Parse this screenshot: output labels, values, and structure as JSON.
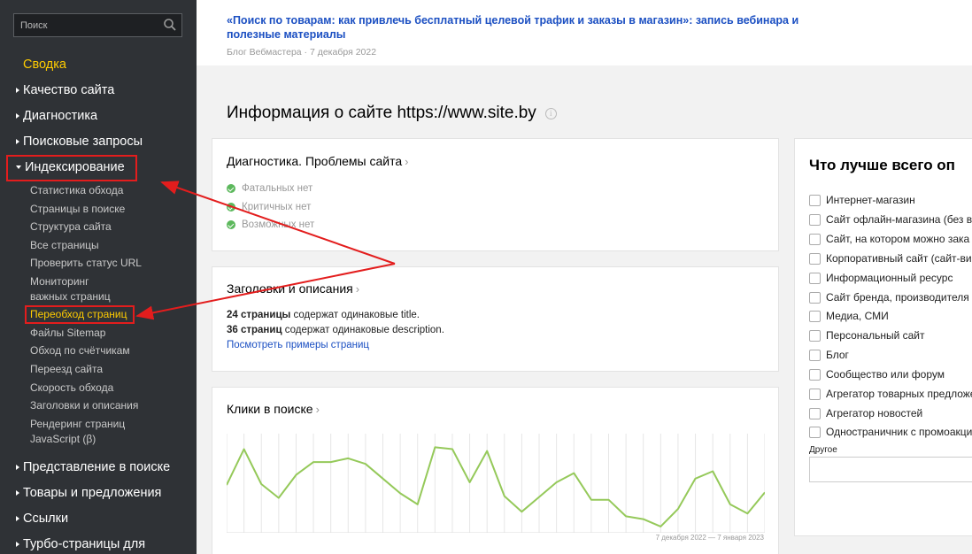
{
  "search": {
    "placeholder": "Поиск",
    "icon": "search-icon"
  },
  "sidebar": {
    "summary": "Сводка",
    "sections": [
      "Качество сайта",
      "Диагностика",
      "Поисковые запросы",
      "Индексирование",
      "Представление в поиске",
      "Товары и предложения",
      "Ссылки",
      "Турбо-страницы для"
    ],
    "indexing_items": [
      "Статистика обхода",
      "Страницы в поиске",
      "Структура сайта",
      "Все страницы",
      "Проверить статус URL",
      "Мониторинг",
      "важных страниц",
      "Переобход страниц",
      "Файлы Sitemap",
      "Обход по счётчикам",
      "Переезд сайта",
      "Скорость обхода",
      "Заголовки и описания",
      "Рендеринг страниц",
      "JavaScript (β)"
    ],
    "active_color": "#ffcc00"
  },
  "news": {
    "title": "«Поиск по товарам: как привлечь бесплатный целевой трафик и заказы в магазин»: запись вебинара и полезные материалы",
    "meta": "Блог Вебмастера · 7 декабря 2022"
  },
  "page": {
    "title": "Информация о сайте https://www.site.by",
    "info_icon": "info-icon"
  },
  "diagnostics": {
    "title": "Диагностика. Проблемы сайта",
    "items": [
      "Фатальных нет",
      "Критичных нет",
      "Возможных нет"
    ],
    "status_color": "#5cb85c"
  },
  "headers": {
    "title": "Заголовки и описания",
    "line1_count": "24 страницы",
    "line1_text": " содержат одинаковые title.",
    "line2_count": "36 страниц",
    "line2_text": " содержат одинаковые description.",
    "link": "Посмотреть примеры страниц"
  },
  "clicks": {
    "title": "Клики в поиске",
    "caption": "7 декабря 2022 — 7 января 2023"
  },
  "chart_data": {
    "type": "line",
    "title": "Клики в поиске",
    "xlabel": "7 декабря 2022 — 7 января 2023",
    "ylabel": "",
    "x": [
      1,
      2,
      3,
      4,
      5,
      6,
      7,
      8,
      9,
      10,
      11,
      12,
      13,
      14,
      15,
      16,
      17,
      18,
      19,
      20,
      21,
      22,
      23,
      24,
      25,
      26,
      27,
      28,
      29,
      30,
      31
    ],
    "series": [
      {
        "values": [
          48,
          87,
          49,
          34,
          59,
          73,
          73,
          77,
          71,
          55,
          39,
          27,
          89,
          87,
          51,
          85,
          36,
          19,
          35,
          51,
          61,
          32,
          32,
          14,
          11,
          3,
          22,
          55,
          63,
          27,
          17,
          40
        ]
      }
    ],
    "ylim": [
      0,
      100
    ],
    "grid": true,
    "color": "#95c95a"
  },
  "survey": {
    "title": "Что лучше всего оп",
    "options": [
      "Интернет-магазин",
      "Сайт офлайн-магазина (без в",
      "Сайт, на котором можно зака",
      "Корпоративный сайт (сайт-ви",
      "Информационный ресурс",
      "Сайт бренда, производителя",
      "Медиа, СМИ",
      "Персональный сайт",
      "Блог",
      "Сообщество или форум",
      "Агрегатор товарных предложе",
      "Агрегатор новостей",
      "Одностраничник с промоакци"
    ],
    "other_label": "Другое"
  },
  "annotation_color": "#e31d1d"
}
